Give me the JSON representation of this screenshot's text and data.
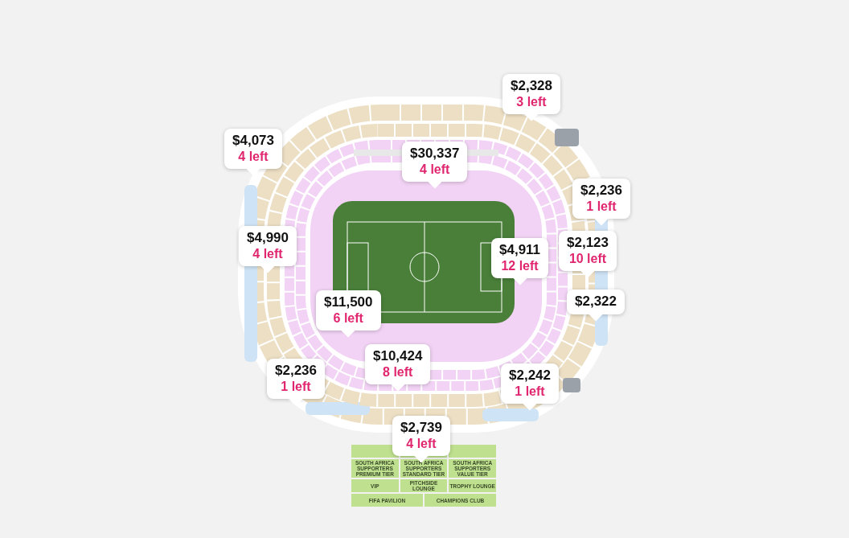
{
  "price_tags": [
    {
      "price": "$2,328",
      "left": "3 left"
    },
    {
      "price": "$4,073",
      "left": "4 left"
    },
    {
      "price": "$30,337",
      "left": "4 left"
    },
    {
      "price": "$2,236",
      "left": "1 left"
    },
    {
      "price": "$4,990",
      "left": "4 left"
    },
    {
      "price": "$2,123",
      "left": "10 left"
    },
    {
      "price": "$4,911",
      "left": "12 left"
    },
    {
      "price": "$2,322"
    },
    {
      "price": "$11,500",
      "left": "6 left"
    },
    {
      "price": "$10,424",
      "left": "8 left"
    },
    {
      "price": "$2,236",
      "left": "1 left"
    },
    {
      "price": "$2,242",
      "left": "1 left"
    },
    {
      "price": "$2,739",
      "left": "4 left"
    }
  ],
  "lounges": [
    [
      "SOUTH AFRICA SUPPORTERS PREMIUM TIER",
      "SOUTH AFRICA SUPPORTERS STANDARD TIER",
      "SOUTH AFRICA SUPPORTERS VALUE TIER"
    ],
    [
      "VIP",
      "PITCHSIDE LOUNGE",
      "TROPHY LOUNGE"
    ],
    [
      "FIFA PAVILION",
      "CHAMPIONS CLUB"
    ]
  ]
}
